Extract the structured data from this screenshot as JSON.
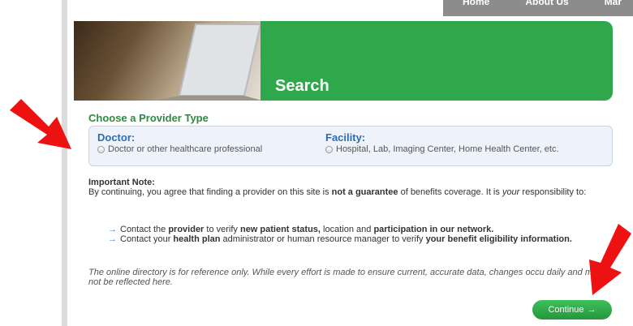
{
  "nav": {
    "items": [
      "Home",
      "About Us",
      "Mar"
    ]
  },
  "banner": {
    "title": "Search"
  },
  "provider_section": {
    "title": "Choose a Provider Type",
    "doctor": {
      "heading": "Doctor:",
      "option": "Doctor or other healthcare professional"
    },
    "facility": {
      "heading": "Facility:",
      "option": "Hospital, Lab, Imaging Center, Home Health Center, etc."
    }
  },
  "note": {
    "heading": "Important Note:",
    "p1_a": "By continuing, you agree that finding a provider on this site is ",
    "p1_b": "not a guarantee",
    "p1_c": " of benefits coverage. It is ",
    "p1_d": "your",
    "p1_e": " responsibility to:",
    "b1_a": "Contact the ",
    "b1_b": "provider",
    "b1_c": " to verify ",
    "b1_d": "new patient status,",
    "b1_e": " location and ",
    "b1_f": "participation in our network.",
    "b2_a": "Contact your ",
    "b2_b": "health plan",
    "b2_c": " administrator or human resource manager to verify ",
    "b2_d": "your benefit eligibility information.",
    "disclaimer": "The online directory is for reference only. While every effort is made to ensure current, accurate data, changes occu daily and may not be reflected here."
  },
  "continue_label": "Continue",
  "colors": {
    "brand_green": "#2ea84a",
    "link_blue": "#2a6db0",
    "arrow_red": "#ee1111"
  }
}
